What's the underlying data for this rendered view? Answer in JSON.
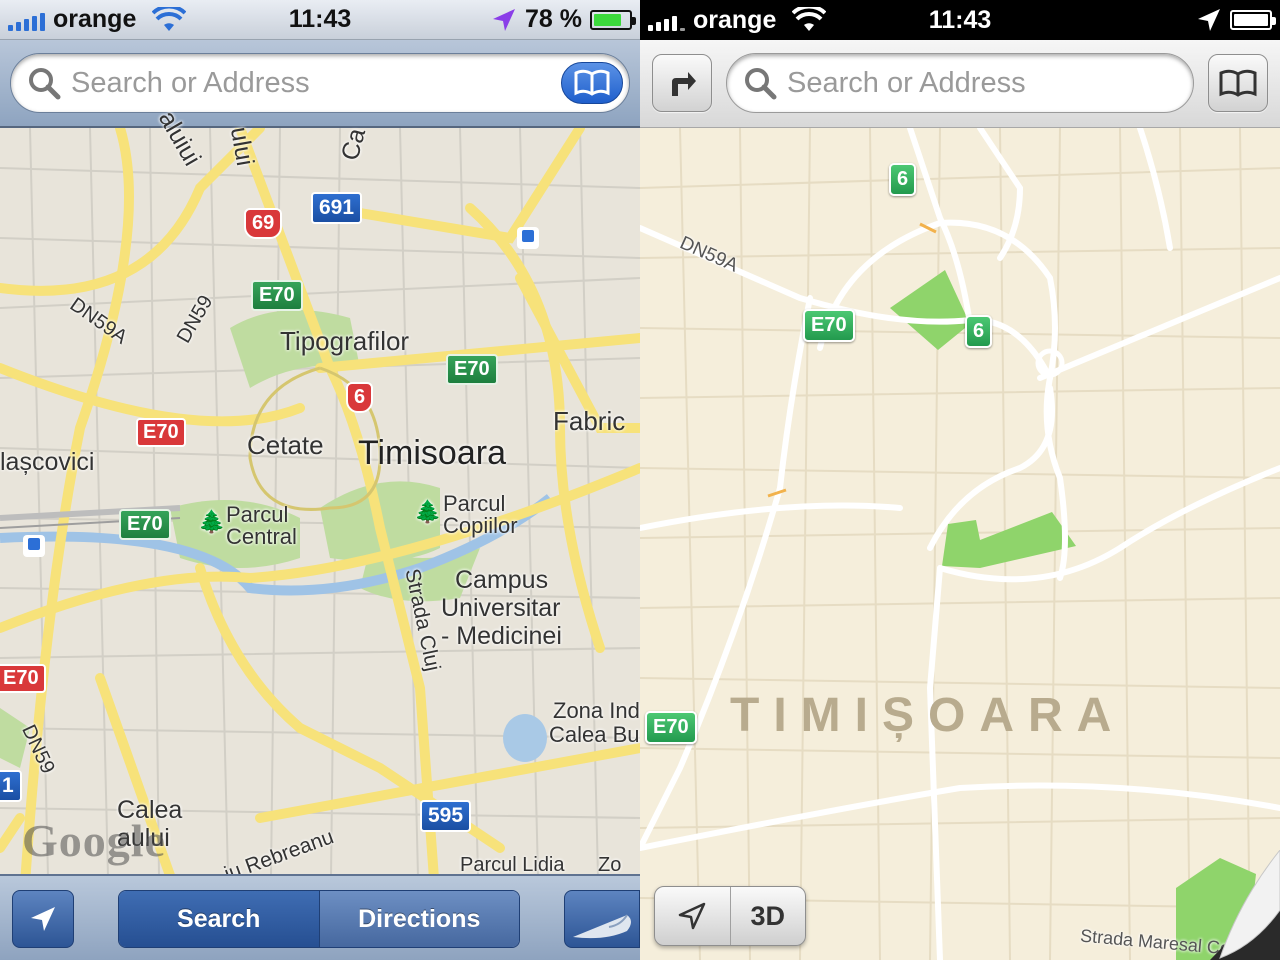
{
  "left": {
    "status": {
      "carrier": "orange",
      "time": "11:43",
      "battery_percent": "78 %",
      "battery_level": 0.78
    },
    "search": {
      "placeholder": "Search or Address"
    },
    "map": {
      "labels": {
        "tipografilor": "Tipografilor",
        "cetate": "Cetate",
        "timisoara": "Timisoara",
        "fabric": "Fabric",
        "lascovici": "lașcovici",
        "parcul_central_1": "Parcul",
        "parcul_central_2": "Central",
        "parcul_copiilor_1": "Parcul",
        "parcul_copiilor_2": "Copiilor",
        "campus_1": "Campus",
        "campus_2": "Universitar",
        "campus_3": "- Medicinei",
        "zona_1": "Zona Indu",
        "zona_2": "Calea Buz",
        "calea_1": "Calea",
        "calea_2": "aului",
        "strada_cluj": "Strada Cluj",
        "rebreanu": "iu Rebreanu",
        "parcul_lidia": "Parcul Lidia",
        "dn59a": "DN59A",
        "dn59": "DN59",
        "dn59_2": "DN59",
        "top_1": "aluiui",
        "top_2": "ului",
        "top_3": "Ca",
        "zo": "Zo"
      },
      "shields": {
        "r691": "691",
        "r69": "69",
        "r6": "6",
        "r595": "595",
        "e70_1": "E70",
        "e70_2": "E70",
        "e70_3": "E70",
        "e70_red": "E70",
        "e70_red2": "E70",
        "r1": "1"
      },
      "attribution": "Google"
    },
    "bottombar": {
      "search_label": "Search",
      "directions_label": "Directions",
      "active": "Search"
    }
  },
  "right": {
    "status": {
      "carrier": "orange",
      "time": "11:43"
    },
    "search": {
      "placeholder": "Search or Address"
    },
    "map": {
      "city": "TIMIȘOARA",
      "road_dn59a": "DN59A",
      "street": "Strada Maresal Co",
      "shields": {
        "r6a": "6",
        "r6b": "6",
        "e70a": "E70",
        "e70b": "E70"
      }
    },
    "controls": {
      "threed_label": "3D"
    }
  },
  "colors": {
    "google_map_bg": "#e8e4da",
    "google_road": "#f7e27a",
    "google_park": "#bfdca0",
    "apple_map_bg": "#f5eedb",
    "apple_park": "#8fd46b",
    "ios_blue": "#2d5595",
    "battery_green": "#3cd93c",
    "location_purple": "#8a3ee8"
  },
  "icons": [
    "signal-icon",
    "wifi-icon",
    "location-arrow-icon",
    "battery-icon",
    "search-icon",
    "bookmarks-icon",
    "directions-turn-icon",
    "page-curl-icon"
  ]
}
